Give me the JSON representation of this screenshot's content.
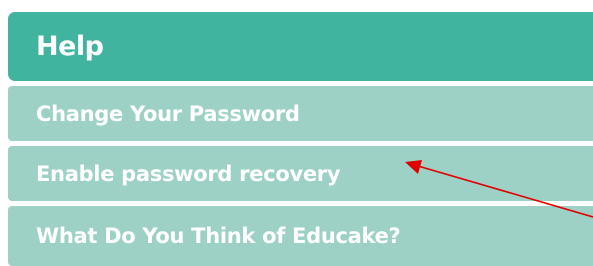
{
  "help": {
    "title": "Help",
    "items": [
      {
        "label": "Change Your Password"
      },
      {
        "label": "Enable password recovery"
      },
      {
        "label": "What Do You Think of Educake?"
      }
    ]
  },
  "annotation": {
    "arrow_color": "#e00000"
  },
  "colors": {
    "header_bg": "#41b49f",
    "item_bg": "#9dd1c5",
    "text": "#ffffff"
  }
}
